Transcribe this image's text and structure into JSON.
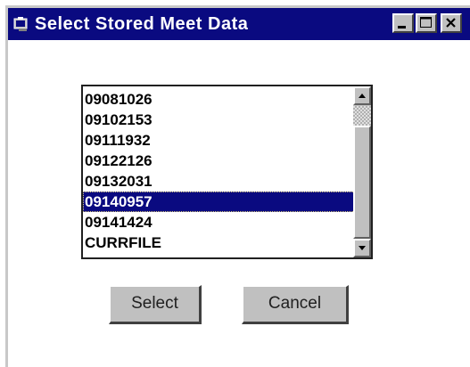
{
  "window": {
    "title": "Select Stored Meet Data",
    "controls": {
      "minimize_icon": "minimize-icon",
      "maximize_icon": "maximize-icon",
      "close_icon": "close-icon"
    }
  },
  "listbox": {
    "items": [
      "09081026",
      "09102153",
      "09111932",
      "09122126",
      "09132031",
      "09140957",
      "09141424",
      "CURRFILE"
    ],
    "selected_index": 5
  },
  "buttons": {
    "select_label": "Select",
    "cancel_label": "Cancel"
  },
  "colors": {
    "titlebar": "#0a0a80",
    "selection": "#0a0a80",
    "face": "#c0c0c0"
  }
}
